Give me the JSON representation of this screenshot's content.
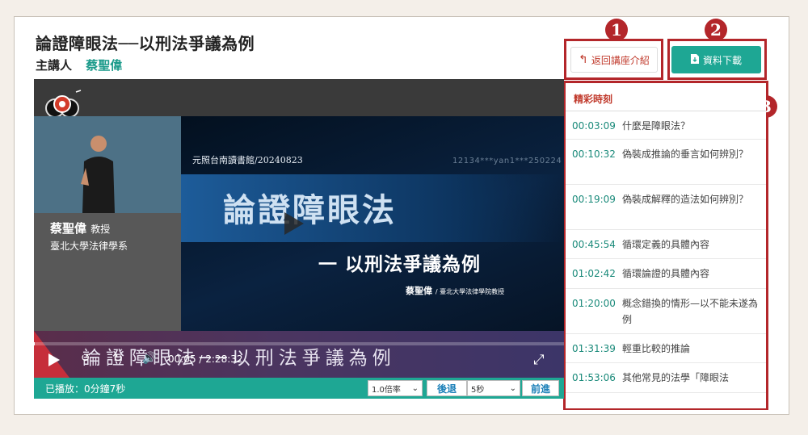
{
  "page": {
    "title": "論證障眼法──以刑法爭議為例",
    "speaker_label": "主講人",
    "speaker_name": "蔡聖偉"
  },
  "buttons": {
    "back_label": "返回講座介紹",
    "download_label": "資料下載"
  },
  "badges": [
    "1",
    "2",
    "3"
  ],
  "video": {
    "lecturer_name": "蔡聖偉",
    "lecturer_title": "教授",
    "lecturer_dept": "臺北大學法律學系",
    "slide_library": "元照台南讀書館/20240823",
    "slide_watermark": "12134***yan1***250224",
    "slide_title_main": "論證障眼法",
    "slide_title_sub": "一 以刑法爭議為例",
    "slide_author": "蔡聖偉",
    "slide_author_affil": "/ 臺北大學法律學院教授",
    "band_title": "論證障眼法──以刑法爭議為例",
    "time_display": "00:05 / 2:28:32",
    "progress_fraction": 0.001
  },
  "status": {
    "played_text": "已播放：0分鐘7秒",
    "speed_value": "1.0倍率",
    "back_button": "後退",
    "seek_value": "5秒",
    "forward_button": "前進"
  },
  "highlights": {
    "header": "精彩時刻",
    "items": [
      {
        "time": "00:03:09",
        "text": "什麼是障眼法？"
      },
      {
        "time": "00:10:32",
        "text": "偽裝成推論的垂言如何辨別？"
      },
      {
        "time": "00:19:09",
        "text": "偽裝成解釋的造法如何辨別？"
      },
      {
        "time": "00:45:54",
        "text": "循環定義的具體內容"
      },
      {
        "time": "01:02:42",
        "text": "循環論證的具體內容"
      },
      {
        "time": "01:20:00",
        "text": "概念錯換的情形—以不能未遂為例"
      },
      {
        "time": "01:31:39",
        "text": "輕重比較的推論"
      },
      {
        "time": "01:53:06",
        "text": "其他常見的法學「障眼法"
      }
    ]
  },
  "colors": {
    "accent": "#1ea794",
    "annotation_red": "#b3262a",
    "highlight_header": "#c0392b"
  }
}
